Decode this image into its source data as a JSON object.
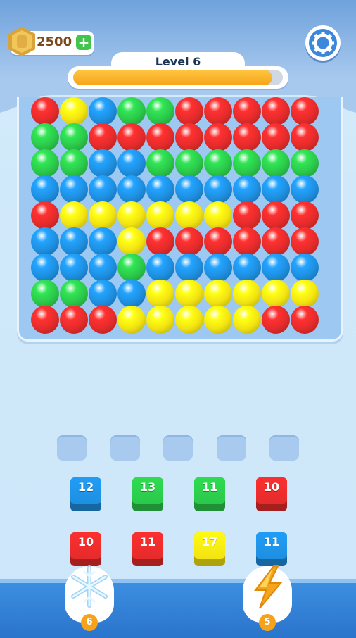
{
  "header": {
    "coins": "2500",
    "plus_label": "+",
    "level_label": "Level 6",
    "progress": 0.95,
    "gear_icon": "gear-icon",
    "coin_icon": "coin-icon"
  },
  "colors": {
    "red": "#e52b2b",
    "green": "#2bc84a",
    "blue": "#1e8fe0",
    "yellow": "#f2e312"
  },
  "board": {
    "rows": [
      [
        "R",
        "Y",
        "B",
        "G",
        "G",
        "R",
        "R",
        "R",
        "R",
        "R"
      ],
      [
        "G",
        "G",
        "R",
        "R",
        "R",
        "R",
        "R",
        "R",
        "R",
        "R"
      ],
      [
        "G",
        "G",
        "B",
        "B",
        "G",
        "G",
        "G",
        "G",
        "G",
        "G"
      ],
      [
        "B",
        "B",
        "B",
        "B",
        "B",
        "B",
        "B",
        "B",
        "B",
        "B"
      ],
      [
        "R",
        "Y",
        "Y",
        "Y",
        "Y",
        "Y",
        "Y",
        "R",
        "R",
        "R"
      ],
      [
        "B",
        "B",
        "B",
        "Y",
        "R",
        "R",
        "R",
        "R",
        "R",
        "R"
      ],
      [
        "B",
        "B",
        "B",
        "G",
        "B",
        "B",
        "B",
        "B",
        "B",
        "B"
      ],
      [
        "G",
        "G",
        "B",
        "B",
        "Y",
        "Y",
        "Y",
        "Y",
        "Y",
        "Y"
      ],
      [
        "R",
        "R",
        "R",
        "Y",
        "Y",
        "Y",
        "Y",
        "Y",
        "R",
        "R"
      ]
    ]
  },
  "slots": 5,
  "blocks": [
    {
      "color": "B",
      "value": "12"
    },
    {
      "color": "G",
      "value": "13"
    },
    {
      "color": "G",
      "value": "11"
    },
    {
      "color": "R",
      "value": "10"
    },
    {
      "color": "R",
      "value": "10"
    },
    {
      "color": "R",
      "value": "11"
    },
    {
      "color": "Y",
      "value": "17"
    },
    {
      "color": "B",
      "value": "11"
    }
  ],
  "boosters": [
    {
      "name": "freeze",
      "icon": "snowflake-icon",
      "count": "6"
    },
    {
      "name": "lightning",
      "icon": "lightning-icon",
      "count": "5"
    }
  ]
}
